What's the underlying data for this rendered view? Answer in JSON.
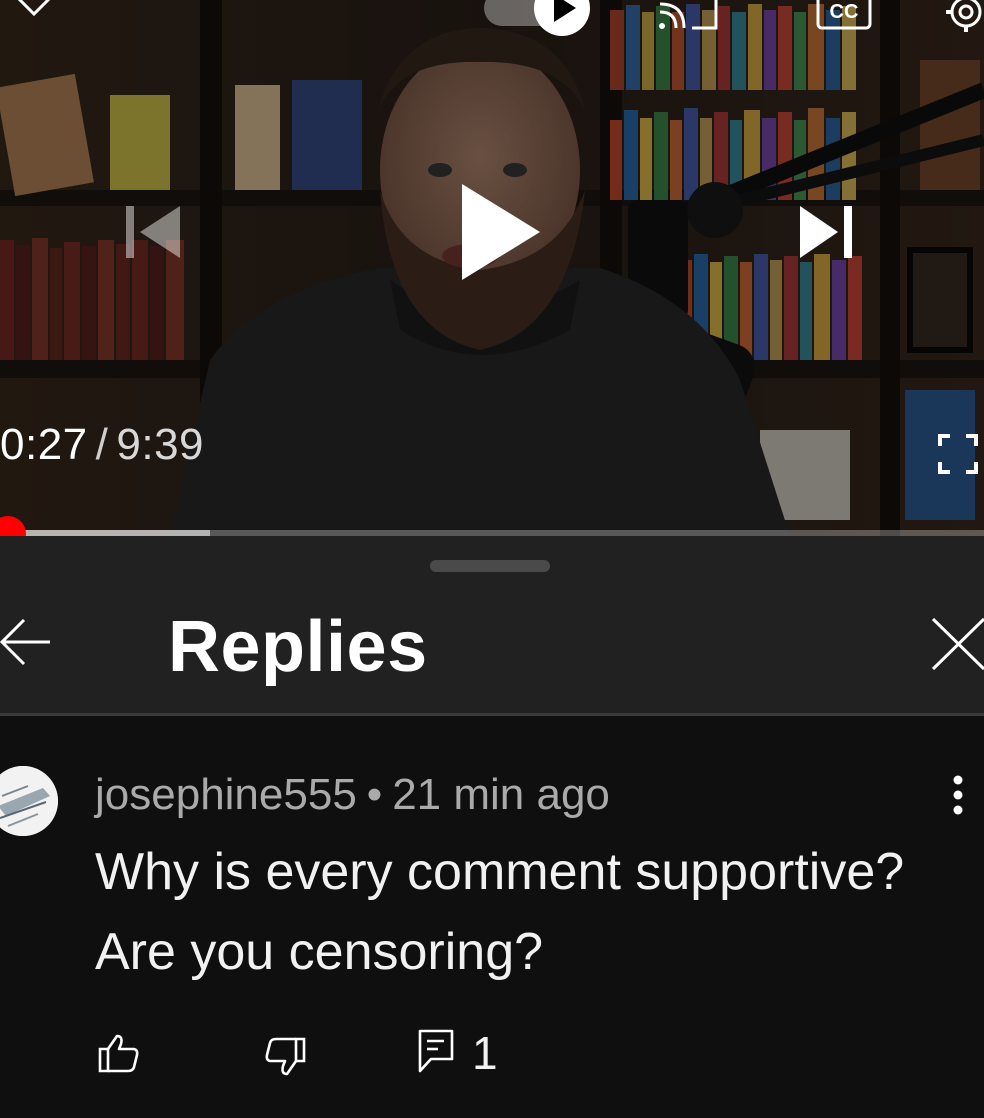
{
  "player": {
    "current_time": "0:27",
    "separator": "/",
    "duration": "9:39",
    "progress": {
      "played_fraction": 0.0,
      "buffered_fraction": 0.213
    },
    "icons": {
      "collapse": "chevron-down-icon",
      "autoplay": "autoplay-toggle-icon",
      "cast": "cast-icon",
      "captions": "closed-captions-icon",
      "settings": "gear-icon",
      "previous": "skip-previous-icon",
      "play": "play-icon",
      "next": "skip-next-icon",
      "fullscreen": "fullscreen-icon"
    },
    "captions_label": "CC"
  },
  "panel": {
    "title": "Replies",
    "icons": {
      "back": "arrow-left-icon",
      "close": "close-icon"
    }
  },
  "comment": {
    "author": "josephine555",
    "meta_separator": "•",
    "age": "21 min ago",
    "text": "Why is every comment supportive? Are you censoring?",
    "reply_count": "1",
    "icons": {
      "more": "more-vertical-icon",
      "like": "thumbs-up-icon",
      "dislike": "thumbs-down-icon",
      "reply": "reply-comment-icon"
    }
  },
  "colors": {
    "progress_played": "#ff0000",
    "panel_header_bg": "#212121",
    "panel_bg": "#0f0f0f",
    "meta_text": "#aaaaaa"
  }
}
